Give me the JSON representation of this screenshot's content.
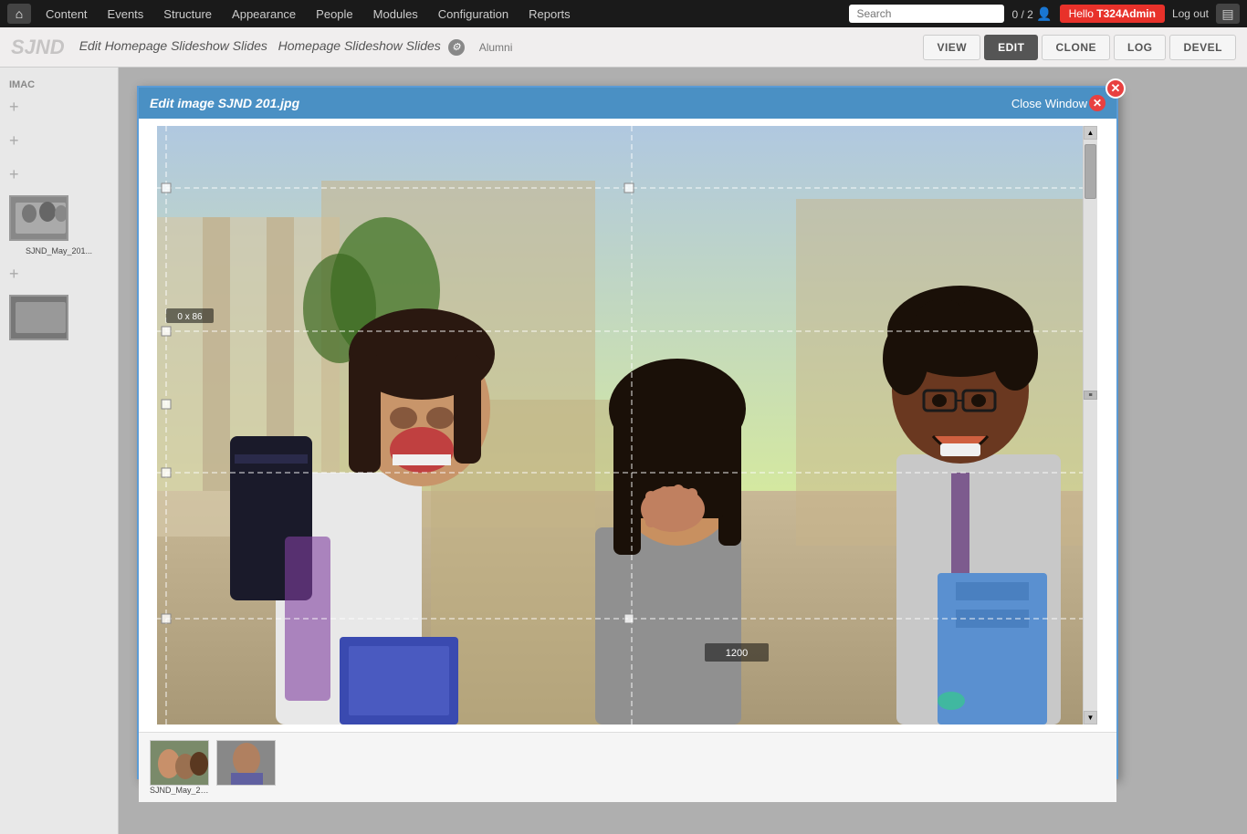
{
  "nav": {
    "home_icon": "⌂",
    "items": [
      "Content",
      "Events",
      "Structure",
      "Appearance",
      "People",
      "Modules",
      "Configuration",
      "Reports"
    ],
    "search_placeholder": "Search",
    "page_count": "0 / 2",
    "user_label": "Hello ",
    "user_name": "T324Admin",
    "logout_label": "Log out",
    "settings_icon": "▤"
  },
  "action_bar": {
    "site_logo": "SJND",
    "breadcrumb_edit": "Edit Homepage Slideshow Slides",
    "breadcrumb_page": "Homepage Slideshow Slides",
    "settings_icon": "⚙",
    "alumni_label": "Alumni",
    "buttons": [
      "VIEW",
      "EDIT",
      "CLONE",
      "LOG",
      "DEVEL"
    ],
    "active_button": "EDIT"
  },
  "modal": {
    "title_edit": "Edit image",
    "title_filename": "SJND 201.jpg",
    "close_label": "Close Window",
    "crop_dim_label": "1200",
    "crop_size_label": "0 x 86"
  },
  "left_sidebar": {
    "section_label": "IMAC",
    "plus_icons": [
      "+",
      "+",
      "+",
      "+"
    ],
    "thumb_label": "SJND_May_201...",
    "thumb_label2": ""
  }
}
